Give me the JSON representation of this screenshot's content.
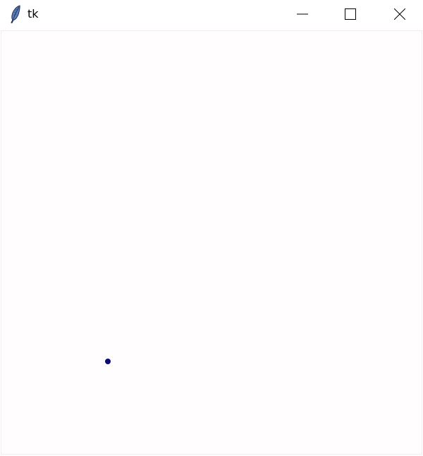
{
  "window": {
    "title": "tk",
    "app_icon": "feather-icon",
    "controls": {
      "minimize_icon": "minimize-icon",
      "maximize_icon": "maximize-icon",
      "close_icon": "close-icon"
    }
  },
  "canvas": {
    "background": "#fffdfd",
    "dot": {
      "color": "#0a0a7a"
    }
  }
}
